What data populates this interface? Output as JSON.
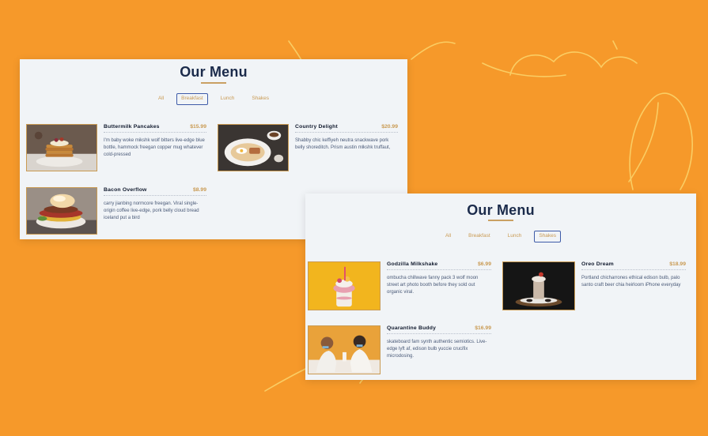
{
  "colors": {
    "background": "#F6992A",
    "panel": "#F1F4F7",
    "title": "#1B2B4B",
    "accent": "#C99A52",
    "active_tab_border": "#3E5BA8"
  },
  "panels": [
    {
      "title": "Our Menu",
      "tabs": [
        "All",
        "Breakfast",
        "Lunch",
        "Shakes"
      ],
      "active_tab": "Breakfast",
      "items": [
        {
          "name": "Buttermilk Pancakes",
          "price": "$15.99",
          "desc": "I'm baby woke mikshk wolf bitters live-edge blue bottle, hammock freegan copper mug whatever cold-pressed",
          "image": "pancakes-photo"
        },
        {
          "name": "Country Delight",
          "price": "$20.99",
          "desc": "Shabby chic keffiyeh neutra snackwave pork belly shoreditch. Prism austin mlkshk truffaut,",
          "image": "breakfast-plate-photo"
        },
        {
          "name": "Bacon Overflow",
          "price": "$8.99",
          "desc": "carry jianbing normcore freegan. Viral single-origin coffee live-edge, pork belly cloud bread iceland put a bird",
          "image": "bacon-burger-photo"
        }
      ]
    },
    {
      "title": "Our Menu",
      "tabs": [
        "All",
        "Breakfast",
        "Lunch",
        "Shakes"
      ],
      "active_tab": "Shakes",
      "items": [
        {
          "name": "Godzilla Milkshake",
          "price": "$6.99",
          "desc": "ombucha chillwave fanny pack 3 wolf moon street art photo booth before they sold out organic viral.",
          "image": "milkshake-photo"
        },
        {
          "name": "Oreo Dream",
          "price": "$18.99",
          "desc": "Portland chicharrones ethical edison bulb, palo santo craft beer chia heirloom iPhone everyday",
          "image": "oreo-shake-photo"
        },
        {
          "name": "Quarantine Buddy",
          "price": "$16.99",
          "desc": "skateboard fam synth authentic semiotics. Live-edge lyft af, edison bulb yuccie crucifix microdosing.",
          "image": "couple-shake-photo"
        }
      ]
    }
  ]
}
